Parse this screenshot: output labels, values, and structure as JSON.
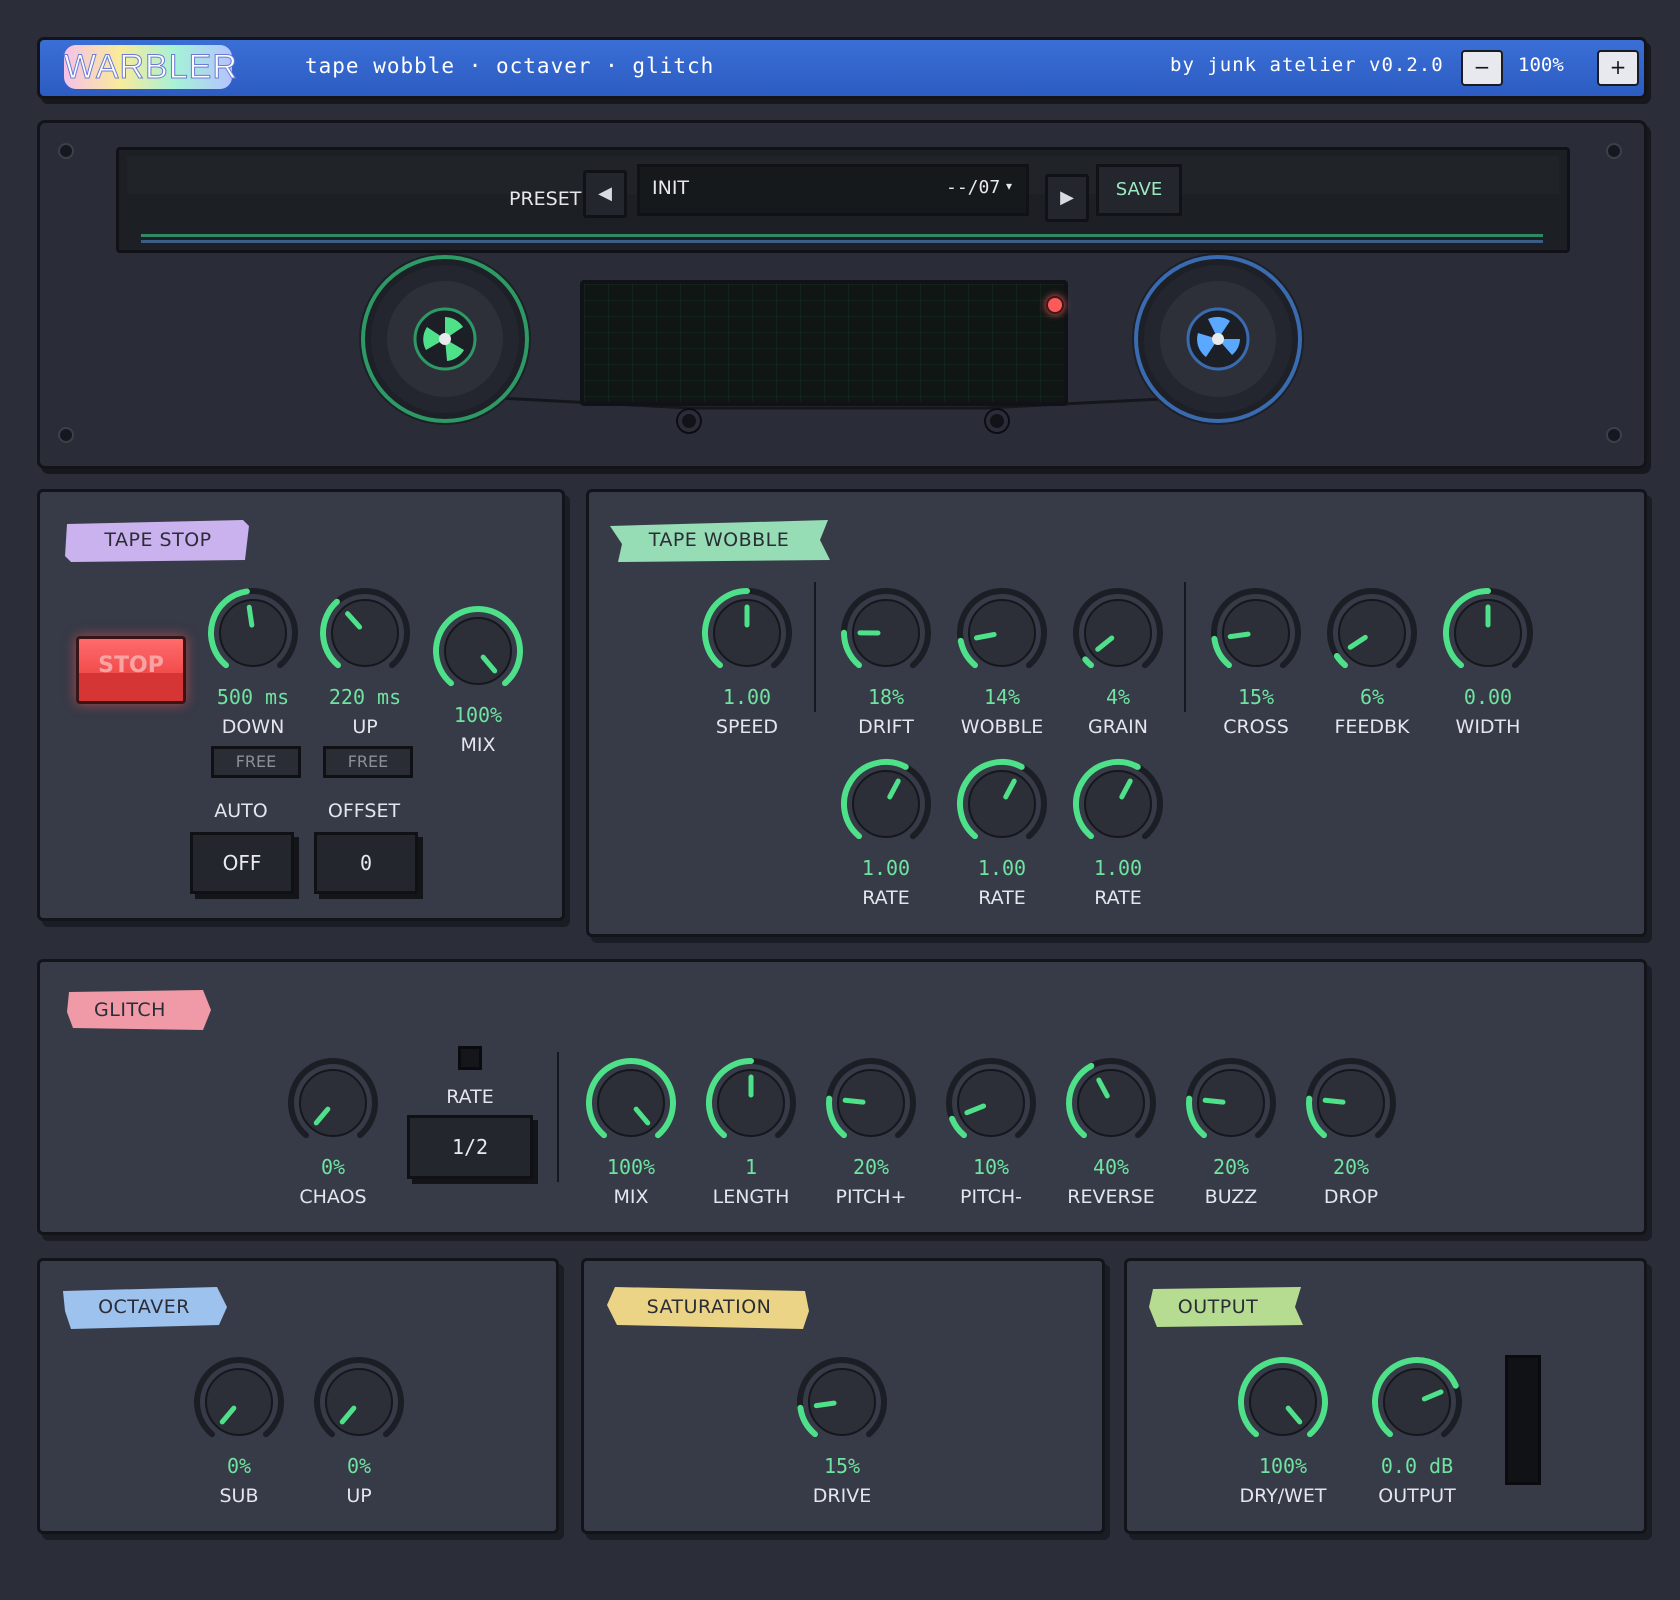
{
  "app": {
    "logo": "WARBLER",
    "tagline": "tape wobble · octaver · glitch",
    "byline": "by junk atelier  v0.2.0",
    "zoom_out": "−",
    "zoom_value": "100%",
    "zoom_in": "+"
  },
  "deck": {
    "preset_label": "PRESET",
    "prev": "◀",
    "next": "▶",
    "preset_name": "INIT",
    "preset_count": "--/07",
    "preset_caret": "▾",
    "save": "SAVE"
  },
  "colors": {
    "accent_green": "#4fe08a",
    "accent_blue": "#5aa8ff",
    "knob_track": "#1c1e25",
    "tape_stop": "#c9b2ee",
    "tape_wobble": "#96dcb4",
    "glitch": "#ef9aa6",
    "octaver": "#9dc2ee",
    "saturation": "#ebd486",
    "output": "#b6dc92"
  },
  "tape_stop": {
    "title": "TAPE STOP",
    "stop_button": "STOP",
    "knobs": [
      {
        "value": "500 ms",
        "label": "DOWN",
        "fraction": 0.47
      },
      {
        "value": "220 ms",
        "label": "UP",
        "fraction": 0.35
      },
      {
        "value": "100%",
        "label": "MIX",
        "fraction": 1.0
      }
    ],
    "free_down": "FREE",
    "free_up": "FREE",
    "auto_label": "AUTO",
    "auto_value": "OFF",
    "offset_label": "OFFSET",
    "offset_value": "0"
  },
  "tape_wobble": {
    "title": "TAPE WOBBLE",
    "knobs": [
      {
        "value": "1.00",
        "label": "SPEED",
        "fraction": 0.5
      },
      {
        "value": "18%",
        "label": "DRIFT",
        "fraction": 0.18
      },
      {
        "value": "14%",
        "label": "WOBBLE",
        "fraction": 0.14
      },
      {
        "value": "4%",
        "label": "GRAIN",
        "fraction": 0.04
      },
      {
        "value": "15%",
        "label": "CROSS",
        "fraction": 0.15
      },
      {
        "value": "6%",
        "label": "FEEDBK",
        "fraction": 0.06
      },
      {
        "value": "0.00",
        "label": "WIDTH",
        "fraction": 0.5
      }
    ],
    "rate_knobs": [
      {
        "value": "1.00",
        "label": "RATE",
        "fraction": 0.6
      },
      {
        "value": "1.00",
        "label": "RATE",
        "fraction": 0.6
      },
      {
        "value": "1.00",
        "label": "RATE",
        "fraction": 0.6
      }
    ]
  },
  "glitch": {
    "title": "GLITCH",
    "chaos": {
      "value": "0%",
      "label": "CHAOS",
      "fraction": 0.0
    },
    "rate_label": "RATE",
    "rate_value": "1/2",
    "knobs": [
      {
        "value": "100%",
        "label": "MIX",
        "fraction": 1.0
      },
      {
        "value": "1",
        "label": "LENGTH",
        "fraction": 0.5
      },
      {
        "value": "20%",
        "label": "PITCH+",
        "fraction": 0.2
      },
      {
        "value": "10%",
        "label": "PITCH-",
        "fraction": 0.1
      },
      {
        "value": "40%",
        "label": "REVERSE",
        "fraction": 0.4
      },
      {
        "value": "20%",
        "label": "BUZZ",
        "fraction": 0.2
      },
      {
        "value": "20%",
        "label": "DROP",
        "fraction": 0.2
      }
    ]
  },
  "octaver": {
    "title": "OCTAVER",
    "knobs": [
      {
        "value": "0%",
        "label": "SUB",
        "fraction": 0.0
      },
      {
        "value": "0%",
        "label": "UP",
        "fraction": 0.0
      }
    ]
  },
  "saturation": {
    "title": "SATURATION",
    "knobs": [
      {
        "value": "15%",
        "label": "DRIVE",
        "fraction": 0.15
      }
    ]
  },
  "output": {
    "title": "OUTPUT",
    "knobs": [
      {
        "value": "100%",
        "label": "DRY/WET",
        "fraction": 1.0
      },
      {
        "value": "0.0 dB",
        "label": "OUTPUT",
        "fraction": 0.74
      }
    ]
  }
}
